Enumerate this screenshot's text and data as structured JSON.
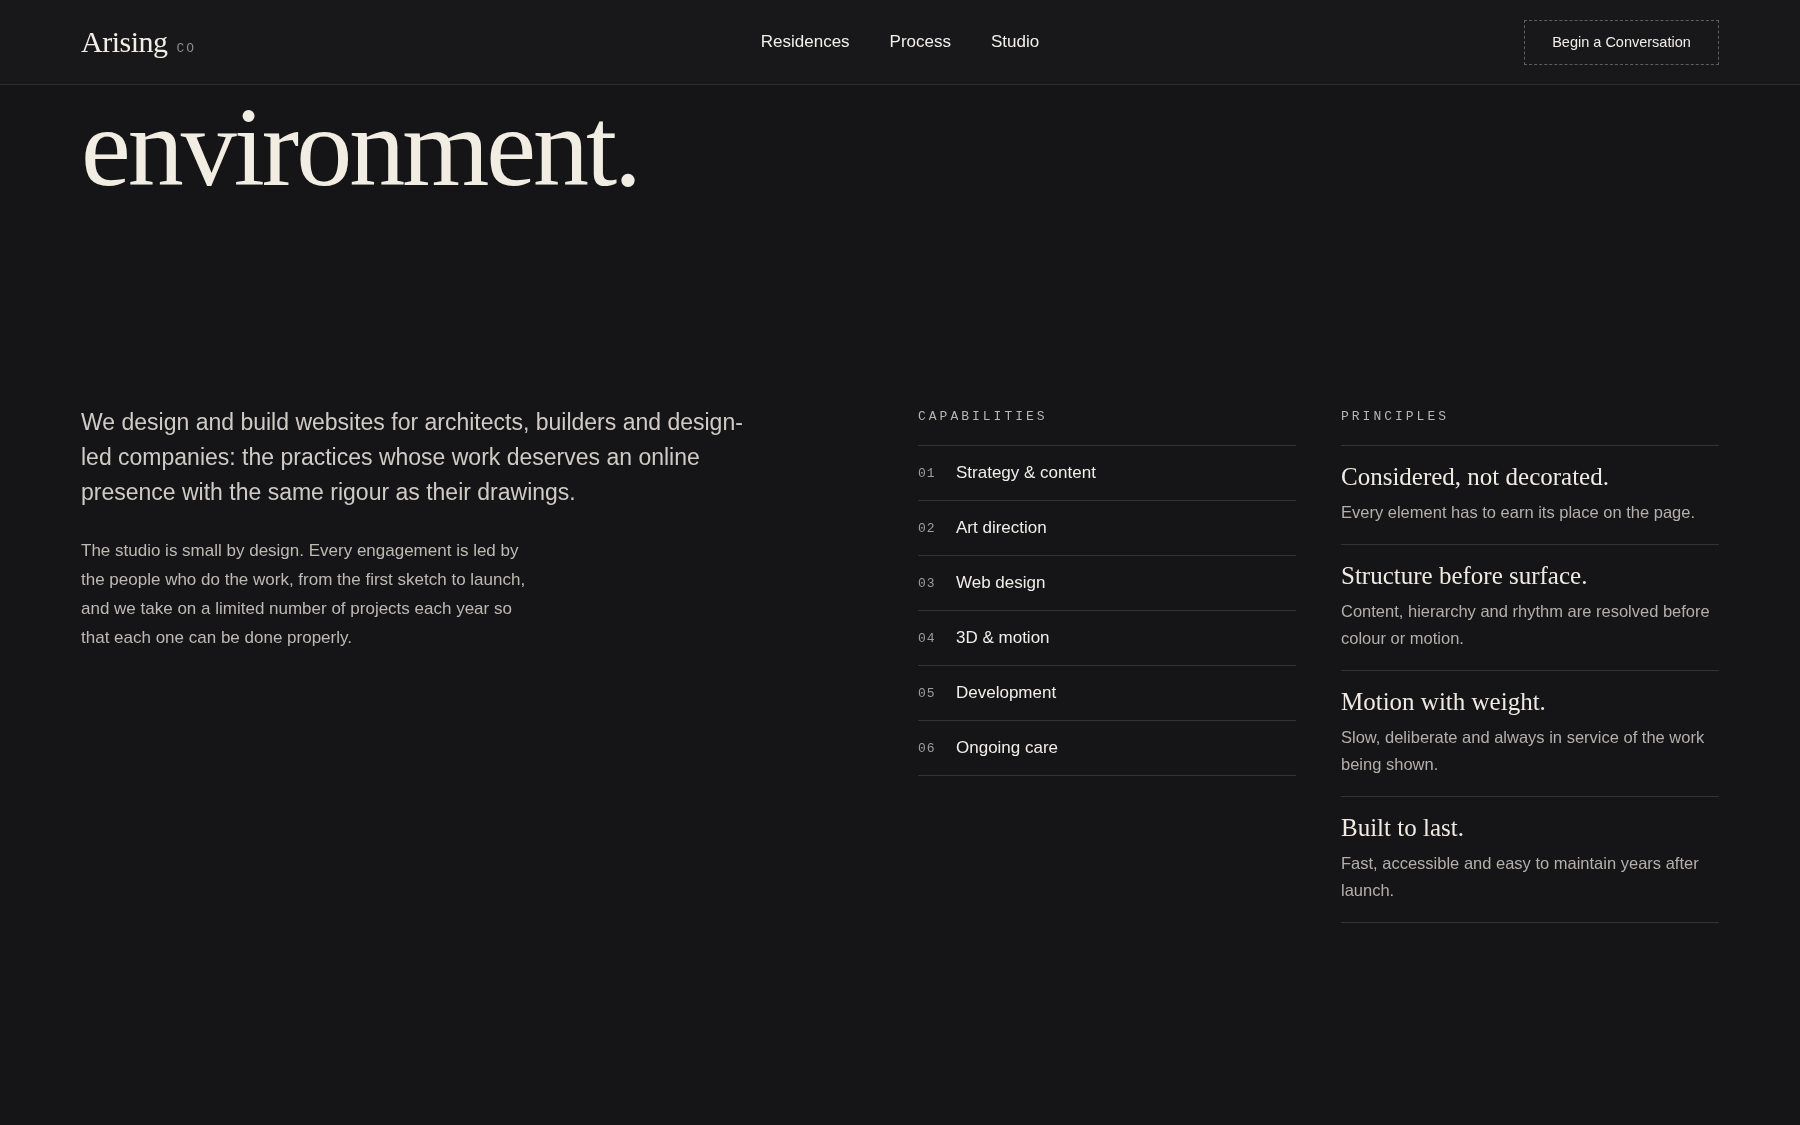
{
  "header": {
    "logo": "Arising",
    "logo_suffix": "CO",
    "nav": [
      {
        "label": "Residences"
      },
      {
        "label": "Process"
      },
      {
        "label": "Studio"
      }
    ],
    "cta": "Begin a Conversation"
  },
  "hero": {
    "heading": "environment."
  },
  "intro": {
    "lead": "We design and build websites for architects, builders and design-led companies: the practices whose work deserves an online presence with the same rigour as their drawings.",
    "body": "The studio is small by design. Every engagement is led by the people who do the work, from the first sketch to launch, and we take on a limited number of projects each year so that each one can be done properly."
  },
  "capabilities": {
    "title": "CAPABILITIES",
    "items": [
      {
        "number": "01",
        "label": "Strategy & content"
      },
      {
        "number": "02",
        "label": "Art direction"
      },
      {
        "number": "03",
        "label": "Web design"
      },
      {
        "number": "04",
        "label": "3D & motion"
      },
      {
        "number": "05",
        "label": "Development"
      },
      {
        "number": "06",
        "label": "Ongoing care"
      }
    ]
  },
  "principles": {
    "title": "PRINCIPLES",
    "items": [
      {
        "title": "Considered, not decorated.",
        "text": "Every element has to earn its place on the page."
      },
      {
        "title": "Structure before surface.",
        "text": "Content, hierarchy and rhythm are resolved before colour or motion."
      },
      {
        "title": "Motion with weight.",
        "text": "Slow, deliberate and always in service of the work being shown."
      },
      {
        "title": "Built to last.",
        "text": "Fast, accessible and easy to maintain years after launch."
      }
    ]
  }
}
